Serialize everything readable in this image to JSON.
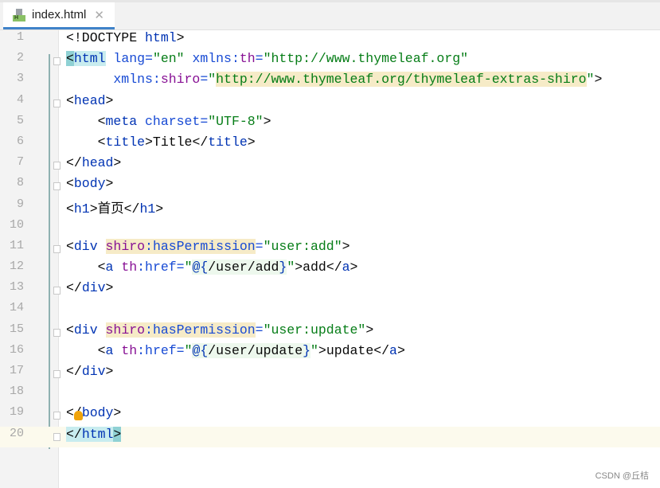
{
  "tab": {
    "title": "index.html",
    "close": "✕",
    "icon_letter": "H"
  },
  "current_line": 20,
  "lines": [
    [
      [
        "<!DOCTYPE ",
        "k"
      ],
      [
        "html",
        "t"
      ],
      [
        ">",
        "k"
      ]
    ],
    [
      [
        "<",
        "brx"
      ],
      [
        "html",
        "t br"
      ],
      [
        " lang=",
        "a"
      ],
      [
        "\"en\"",
        "s"
      ],
      [
        " xmlns:",
        "a"
      ],
      [
        "th",
        "p"
      ],
      [
        "=",
        "a"
      ],
      [
        "\"http://www.thymeleaf.org\"",
        "s"
      ]
    ],
    [
      [
        "      xmlns:",
        "a"
      ],
      [
        "shiro",
        "p"
      ],
      [
        "=",
        "a"
      ],
      [
        "\"",
        "s"
      ],
      [
        "http://www.thymeleaf.org/thymeleaf-extras-shiro",
        "s hl"
      ],
      [
        "\"",
        "s"
      ],
      [
        ">",
        "k"
      ]
    ],
    [
      [
        "<",
        "k"
      ],
      [
        "head",
        "t"
      ],
      [
        ">",
        "k"
      ]
    ],
    [
      [
        "    <",
        "k"
      ],
      [
        "meta",
        "t"
      ],
      [
        " charset=",
        "a"
      ],
      [
        "\"UTF-8\"",
        "s"
      ],
      [
        ">",
        "k"
      ]
    ],
    [
      [
        "    <",
        "k"
      ],
      [
        "title",
        "t"
      ],
      [
        ">Title</",
        "k"
      ],
      [
        "title",
        "t"
      ],
      [
        ">",
        "k"
      ]
    ],
    [
      [
        "</",
        "k"
      ],
      [
        "head",
        "t"
      ],
      [
        ">",
        "k"
      ]
    ],
    [
      [
        "<",
        "k"
      ],
      [
        "body",
        "t"
      ],
      [
        ">",
        "k"
      ]
    ],
    [
      [
        "<",
        "k"
      ],
      [
        "h1",
        "t"
      ],
      [
        ">首页</",
        "k"
      ],
      [
        "h1",
        "t"
      ],
      [
        ">",
        "k"
      ]
    ],
    [],
    [
      [
        "<",
        "k"
      ],
      [
        "div",
        "t"
      ],
      [
        " ",
        "k"
      ],
      [
        "shiro",
        "p hl"
      ],
      [
        ":hasPermission",
        "a hl"
      ],
      [
        "=",
        "a"
      ],
      [
        "\"user:add\"",
        "s"
      ],
      [
        ">",
        "k"
      ]
    ],
    [
      [
        "    <",
        "k"
      ],
      [
        "a",
        "t"
      ],
      [
        " ",
        "k"
      ],
      [
        "th",
        "p"
      ],
      [
        ":href=",
        "a"
      ],
      [
        "\"",
        "s"
      ],
      [
        "@{",
        "t url"
      ],
      [
        "/user/add",
        "k url"
      ],
      [
        "}",
        "t url"
      ],
      [
        "\"",
        "s"
      ],
      [
        ">add</",
        "k"
      ],
      [
        "a",
        "t"
      ],
      [
        ">",
        "k"
      ]
    ],
    [
      [
        "</",
        "k"
      ],
      [
        "div",
        "t"
      ],
      [
        ">",
        "k"
      ]
    ],
    [],
    [
      [
        "<",
        "k"
      ],
      [
        "div",
        "t"
      ],
      [
        " ",
        "k"
      ],
      [
        "shiro",
        "p hl"
      ],
      [
        ":hasPermission",
        "a hl"
      ],
      [
        "=",
        "a"
      ],
      [
        "\"user:update\"",
        "s"
      ],
      [
        ">",
        "k"
      ]
    ],
    [
      [
        "    <",
        "k"
      ],
      [
        "a",
        "t"
      ],
      [
        " ",
        "k"
      ],
      [
        "th",
        "p"
      ],
      [
        ":href=",
        "a"
      ],
      [
        "\"",
        "s"
      ],
      [
        "@{",
        "t url"
      ],
      [
        "/user/update",
        "k url"
      ],
      [
        "}",
        "t url"
      ],
      [
        "\"",
        "s"
      ],
      [
        ">update</",
        "k"
      ],
      [
        "a",
        "t"
      ],
      [
        ">",
        "k"
      ]
    ],
    [
      [
        "</",
        "k"
      ],
      [
        "div",
        "t"
      ],
      [
        ">",
        "k"
      ]
    ],
    [],
    [
      [
        "</",
        "k"
      ],
      [
        "body",
        "t"
      ],
      [
        ">",
        "k"
      ]
    ],
    [
      [
        "</",
        "k br"
      ],
      [
        "html",
        "t br"
      ],
      [
        ">",
        "k brx"
      ]
    ]
  ],
  "folds": [
    2,
    4,
    7,
    8,
    11,
    13,
    15,
    17,
    19,
    20
  ],
  "watermark": "CSDN @丘桔"
}
